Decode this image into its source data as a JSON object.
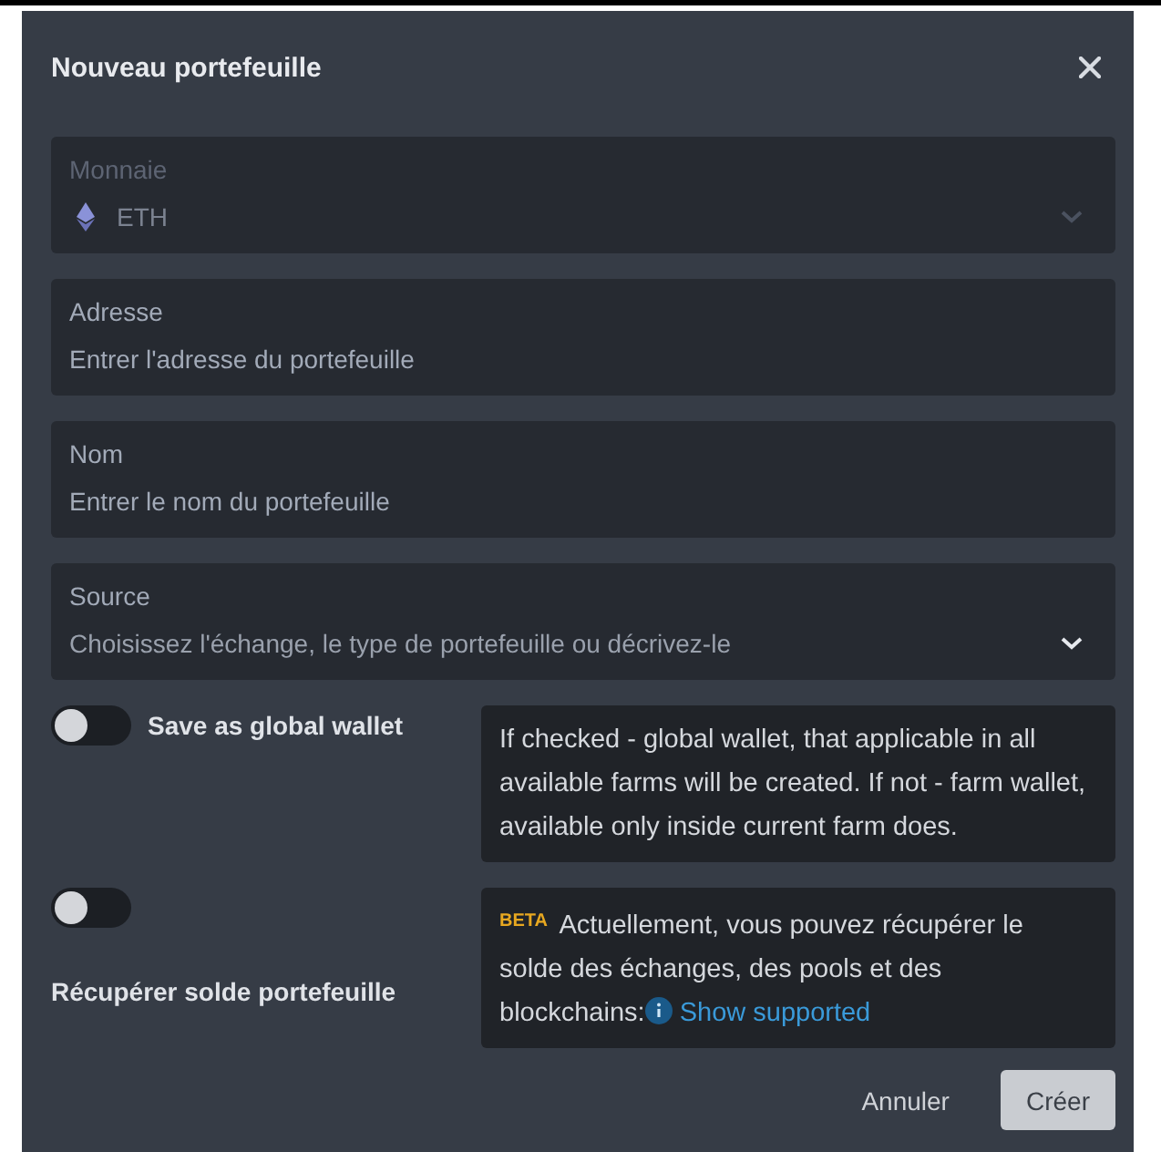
{
  "dialog": {
    "title": "Nouveau portefeuille"
  },
  "fields": [
    {
      "kind": "select",
      "label": "Monnaie",
      "value": "ETH",
      "disabled": true
    },
    {
      "kind": "input",
      "label": "Adresse",
      "placeholder": "Entrer l'adresse du portefeuille"
    },
    {
      "kind": "input",
      "label": "Nom",
      "placeholder": "Entrer le nom du portefeuille"
    },
    {
      "kind": "select",
      "label": "Source",
      "placeholder": "Choisissez l'échange, le type de portefeuille ou décrivez-le",
      "disabled": false
    }
  ],
  "toggles": [
    {
      "label": "Save as global wallet",
      "on": false,
      "note": "If checked - global wallet, that applicable in all available farms will be created. If not - farm wallet, available only inside current farm does."
    },
    {
      "label": "Récupérer solde portefeuille",
      "on": false,
      "badge": "BETA",
      "note": "Actuellement, vous pouvez récupérer le solde des échanges, des pools et des blockchains:",
      "link": "Show supported"
    }
  ],
  "buttons": [
    {
      "label": "Annuler",
      "kind": "text"
    },
    {
      "label": "Créer",
      "kind": "primary"
    }
  ]
}
